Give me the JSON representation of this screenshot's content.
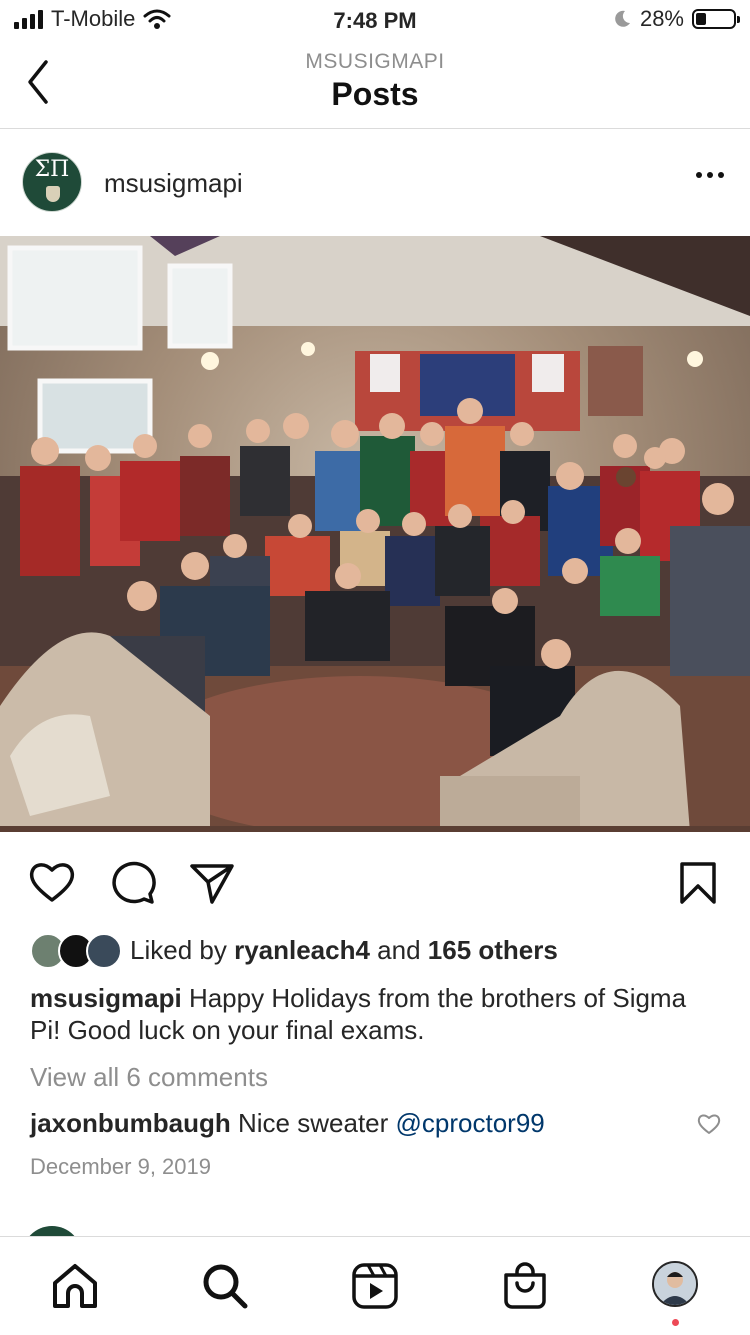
{
  "status_bar": {
    "carrier": "T-Mobile",
    "time": "7:48 PM",
    "battery": "28%",
    "battery_level": 0.28
  },
  "nav": {
    "kicker": "MSUSIGMAPI",
    "title": "Posts"
  },
  "post": {
    "username": "msusigmapi",
    "avatar_letters": "ΣΠ",
    "likes": {
      "prefix": "Liked by ",
      "liker": "ryanleach4",
      "middle": " and ",
      "others": "165 others"
    },
    "caption": {
      "username": "msusigmapi",
      "text": " Happy Holidays from the brothers of Sigma Pi! Good luck on your final exams."
    },
    "view_comments": "View all 6 comments",
    "comment": {
      "username": "jaxonbumbaugh",
      "text": " Nice sweater ",
      "mention": "@cproctor99"
    },
    "date": "December 9, 2019"
  },
  "icons": {
    "back": "chevron-left-icon",
    "more": "more-horizontal-icon",
    "like": "heart-icon",
    "comment": "comment-icon",
    "share": "paper-plane-icon",
    "save": "bookmark-icon",
    "home": "home-icon",
    "search": "search-icon",
    "reels": "reels-icon",
    "shop": "shopping-bag-icon"
  },
  "colors": {
    "text": "#262626",
    "secondary": "#8e8e8e",
    "mention": "#00376b",
    "divider": "#dbdbdb",
    "notification_dot": "#ed4956",
    "avatar_green": "#1f4a38"
  }
}
